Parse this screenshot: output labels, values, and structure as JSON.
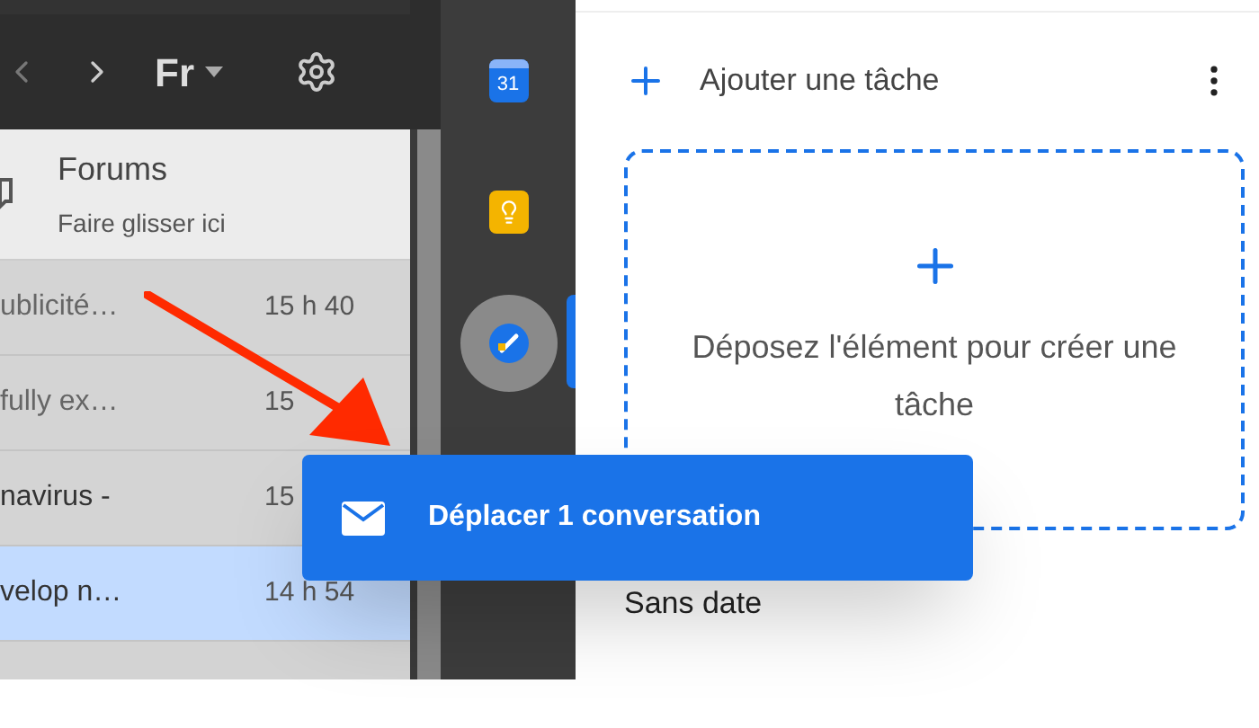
{
  "toolbar": {
    "language": "Fr"
  },
  "category": {
    "title": "Forums",
    "hint": "Faire glisser ici"
  },
  "messages": [
    {
      "subject": "ublicité…",
      "time": "15 h 40",
      "selected": false
    },
    {
      "subject": "fully ex…",
      "time": "15",
      "selected": false
    },
    {
      "subject": "navirus -",
      "time": "15",
      "selected": false
    },
    {
      "subject": "velop n…",
      "time": "14 h 54",
      "selected": true
    }
  ],
  "side_apps": [
    {
      "kind": "calendar",
      "label": "31",
      "selected": false
    },
    {
      "kind": "keep",
      "selected": false
    },
    {
      "kind": "tasks",
      "selected": true
    }
  ],
  "tasks": {
    "add_label": "Ajouter une tâche",
    "drop_text": "Déposez l'élément pour créer une tâche",
    "section": "Sans date"
  },
  "drag_popup": {
    "label": "Déplacer 1 conversation"
  }
}
